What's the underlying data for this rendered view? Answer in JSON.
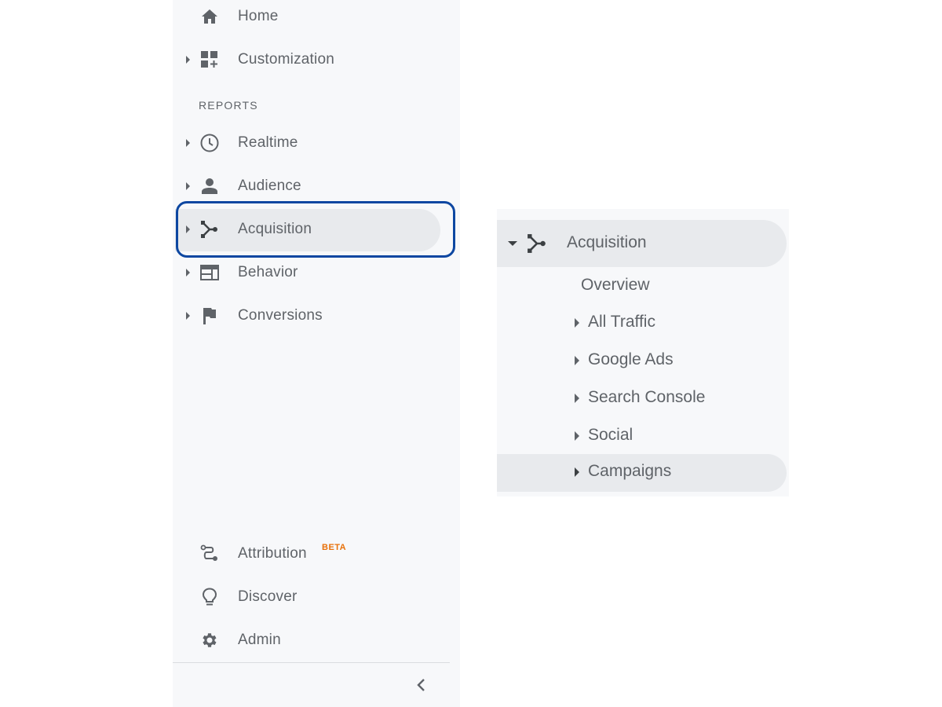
{
  "sidebar": {
    "top_items": [
      {
        "label": "Home",
        "icon": "home-icon",
        "has_caret": false
      },
      {
        "label": "Customization",
        "icon": "dashboard-add-icon",
        "has_caret": true
      }
    ],
    "section_label": "REPORTS",
    "report_items": [
      {
        "label": "Realtime",
        "icon": "clock-icon",
        "has_caret": true
      },
      {
        "label": "Audience",
        "icon": "person-icon",
        "has_caret": true
      },
      {
        "label": "Acquisition",
        "icon": "merge-icon",
        "has_caret": true,
        "active": true
      },
      {
        "label": "Behavior",
        "icon": "web-layout-icon",
        "has_caret": true
      },
      {
        "label": "Conversions",
        "icon": "flag-icon",
        "has_caret": true
      }
    ],
    "bottom_items": [
      {
        "label": "Attribution",
        "icon": "route-icon",
        "badge": "BETA"
      },
      {
        "label": "Discover",
        "icon": "lightbulb-icon"
      },
      {
        "label": "Admin",
        "icon": "gear-icon"
      }
    ],
    "collapse_icon": "chevron-left-icon"
  },
  "submenu": {
    "title": "Acquisition",
    "icon": "merge-icon",
    "items": [
      {
        "label": "Overview",
        "has_caret": false
      },
      {
        "label": "All Traffic",
        "has_caret": true
      },
      {
        "label": "Google Ads",
        "has_caret": true
      },
      {
        "label": "Search Console",
        "has_caret": true
      },
      {
        "label": "Social",
        "has_caret": true
      },
      {
        "label": "Campaigns",
        "has_caret": true,
        "active": true
      }
    ]
  },
  "colors": {
    "highlight_border": "#0d47a1",
    "beta_badge": "#e8710a",
    "sidebar_bg": "#f7f8fa",
    "active_bg": "#e8eaed",
    "text": "#5f6368"
  }
}
